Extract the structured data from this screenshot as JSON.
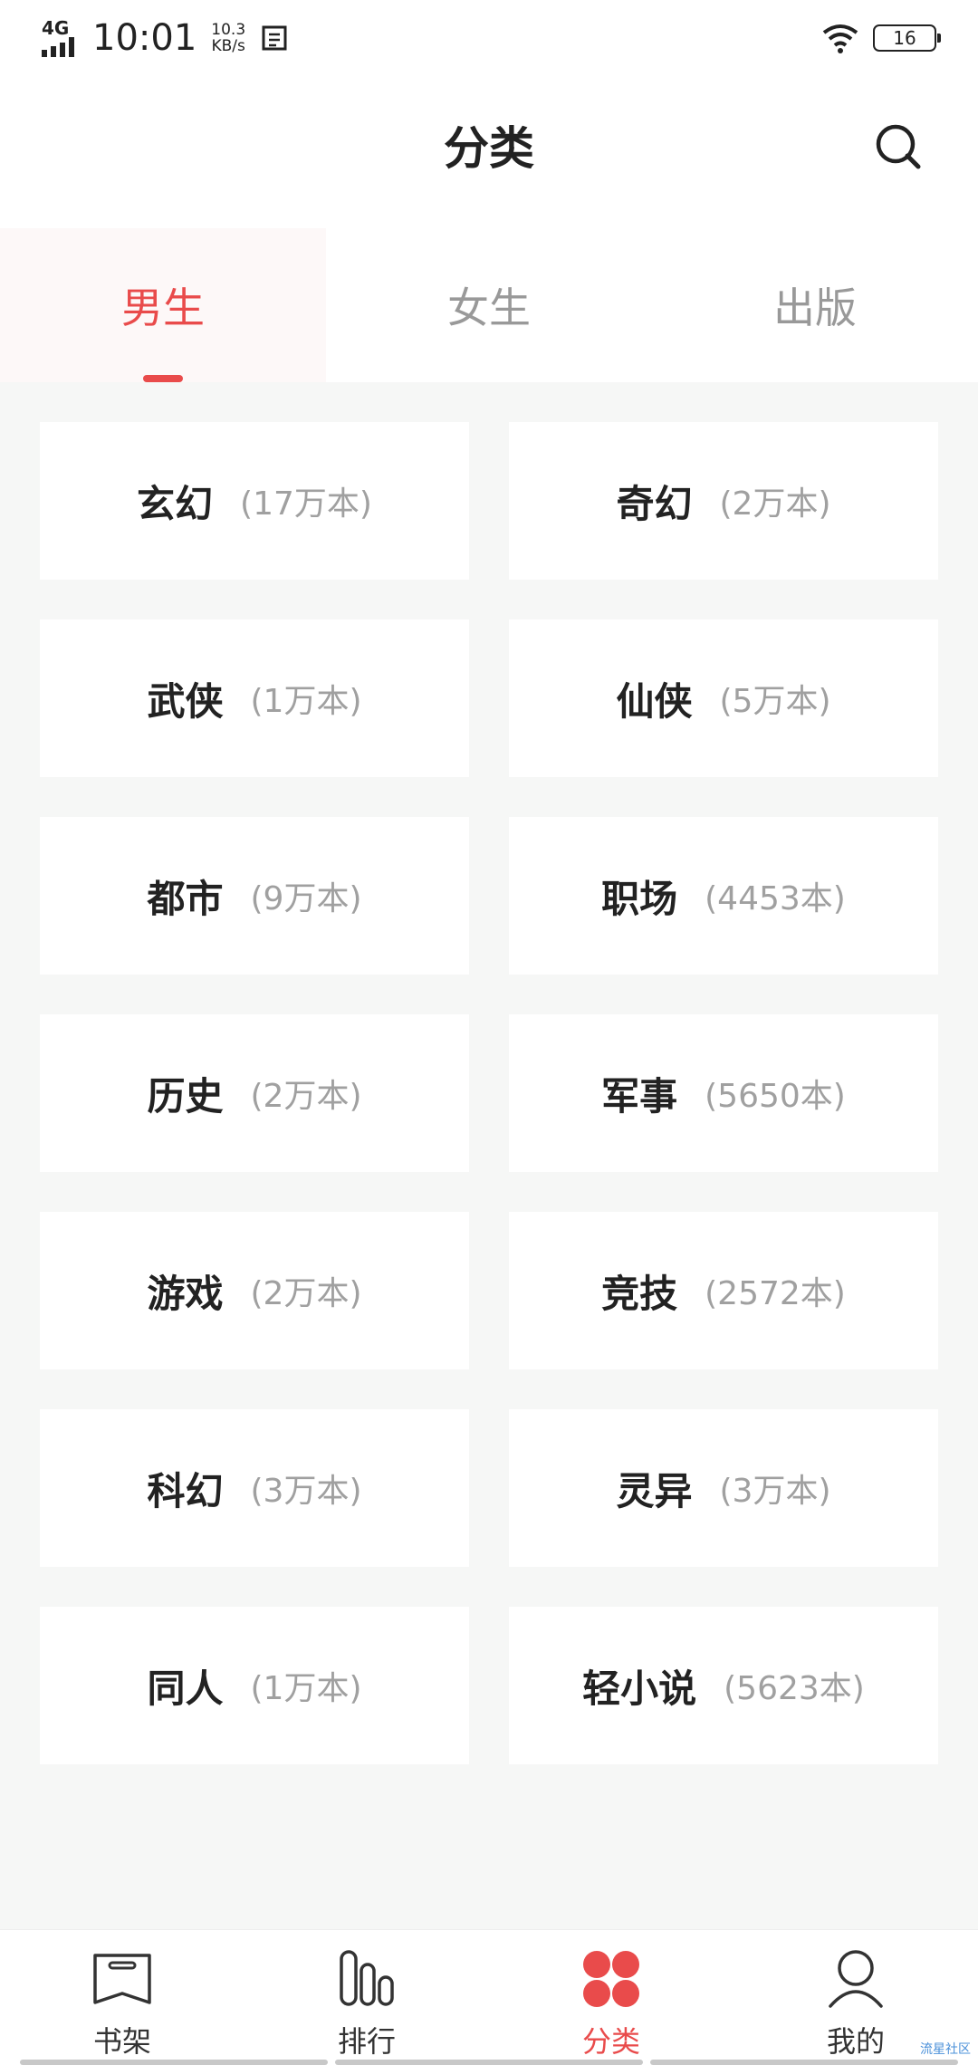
{
  "status_bar": {
    "network": "4G",
    "time": "10:01",
    "speed_value": "10.3",
    "speed_unit": "KB/s",
    "battery": "16"
  },
  "header": {
    "title": "分类",
    "search_icon": "search-icon"
  },
  "tabs": [
    {
      "label": "男生",
      "active": true
    },
    {
      "label": "女生",
      "active": false
    },
    {
      "label": "出版",
      "active": false
    }
  ],
  "categories": [
    {
      "name": "玄幻",
      "count": "(17万本)"
    },
    {
      "name": "奇幻",
      "count": "(2万本)"
    },
    {
      "name": "武侠",
      "count": "(1万本)"
    },
    {
      "name": "仙侠",
      "count": "(5万本)"
    },
    {
      "name": "都市",
      "count": "(9万本)"
    },
    {
      "name": "职场",
      "count": "(4453本)"
    },
    {
      "name": "历史",
      "count": "(2万本)"
    },
    {
      "name": "军事",
      "count": "(5650本)"
    },
    {
      "name": "游戏",
      "count": "(2万本)"
    },
    {
      "name": "竞技",
      "count": "(2572本)"
    },
    {
      "name": "科幻",
      "count": "(3万本)"
    },
    {
      "name": "灵异",
      "count": "(3万本)"
    },
    {
      "name": "同人",
      "count": "(1万本)"
    },
    {
      "name": "轻小说",
      "count": "(5623本)"
    }
  ],
  "bottom_nav": [
    {
      "label": "书架",
      "icon": "bookshelf-icon",
      "active": false
    },
    {
      "label": "排行",
      "icon": "ranking-icon",
      "active": false
    },
    {
      "label": "分类",
      "icon": "category-icon",
      "active": true
    },
    {
      "label": "我的",
      "icon": "profile-icon",
      "active": false
    }
  ],
  "colors": {
    "accent": "#e94b4b",
    "background": "#f6f7f6",
    "card": "#ffffff",
    "muted_text": "#a0a0a0"
  },
  "watermark": "流星社区"
}
